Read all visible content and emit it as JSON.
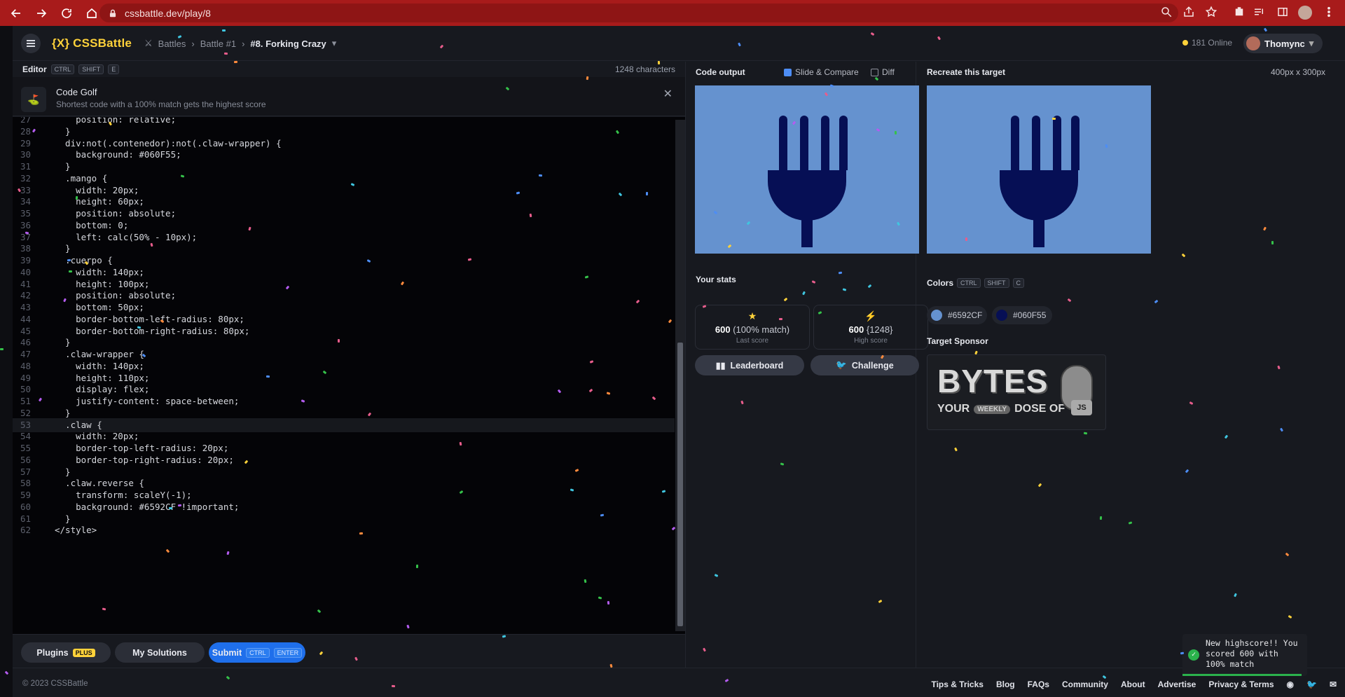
{
  "browser": {
    "url": "cssbattle.dev/play/8"
  },
  "nav": {
    "logo": "{X} CSSBattle",
    "crumbs": [
      "Battles",
      "Battle #1"
    ],
    "current": "#8. Forking Crazy",
    "online": "181 Online",
    "user": "Thomync"
  },
  "editor": {
    "title": "Editor",
    "shortcut": [
      "CTRL",
      "SHIFT",
      "E"
    ],
    "chars": "1248 characters",
    "golf_title": "Code Golf",
    "golf_sub": "Shortest code with a 100% match gets the highest score",
    "lines": [
      {
        "n": "27",
        "t": "    position: relative;"
      },
      {
        "n": "28",
        "t": "  }"
      },
      {
        "n": "29",
        "t": "  div:not(.contenedor):not(.claw-wrapper) {"
      },
      {
        "n": "30",
        "t": "    background: #060F55;"
      },
      {
        "n": "31",
        "t": "  }"
      },
      {
        "n": "32",
        "t": "  .mango {"
      },
      {
        "n": "33",
        "t": "    width: 20px;"
      },
      {
        "n": "34",
        "t": "    height: 60px;"
      },
      {
        "n": "35",
        "t": "    position: absolute;"
      },
      {
        "n": "36",
        "t": "    bottom: 0;"
      },
      {
        "n": "37",
        "t": "    left: calc(50% - 10px);"
      },
      {
        "n": "38",
        "t": "  }"
      },
      {
        "n": "39",
        "t": "  .cuerpo {"
      },
      {
        "n": "40",
        "t": "    width: 140px;"
      },
      {
        "n": "41",
        "t": "    height: 100px;"
      },
      {
        "n": "42",
        "t": "    position: absolute;"
      },
      {
        "n": "43",
        "t": "    bottom: 50px;"
      },
      {
        "n": "44",
        "t": "    border-bottom-left-radius: 80px;"
      },
      {
        "n": "45",
        "t": "    border-bottom-right-radius: 80px;"
      },
      {
        "n": "46",
        "t": "  }"
      },
      {
        "n": "47",
        "t": "  .claw-wrapper {"
      },
      {
        "n": "48",
        "t": "    width: 140px;"
      },
      {
        "n": "49",
        "t": "    height: 110px;"
      },
      {
        "n": "50",
        "t": "    display: flex;"
      },
      {
        "n": "51",
        "t": "    justify-content: space-between;"
      },
      {
        "n": "52",
        "t": "  }"
      },
      {
        "n": "53",
        "t": "  .claw {"
      },
      {
        "n": "54",
        "t": "    width: 20px;"
      },
      {
        "n": "55",
        "t": "    border-top-left-radius: 20px;"
      },
      {
        "n": "56",
        "t": "    border-top-right-radius: 20px;"
      },
      {
        "n": "57",
        "t": "  }"
      },
      {
        "n": "58",
        "t": "  .claw.reverse {"
      },
      {
        "n": "59",
        "t": "    transform: scaleY(-1);"
      },
      {
        "n": "60",
        "t": "    background: #6592CF !important;"
      },
      {
        "n": "61",
        "t": "  }"
      },
      {
        "n": "62",
        "t": "</style>"
      }
    ],
    "plugins": "Plugins",
    "plus": "PLUS",
    "solutions": "My Solutions",
    "submit": "Submit",
    "submit_keys": [
      "CTRL",
      "ENTER"
    ]
  },
  "output": {
    "title": "Code output",
    "slide": "Slide & Compare",
    "diff": "Diff",
    "stats_title": "Your stats",
    "last_value": "600",
    "last_detail": "(100% match)",
    "last_label": "Last score",
    "high_value": "600",
    "high_detail": "{1248}",
    "high_label": "High score",
    "leaderboard": "Leaderboard",
    "challenge": "Challenge"
  },
  "target": {
    "title": "Recreate this target",
    "size": "400px x 300px",
    "colors_title": "Colors",
    "colors_keys": [
      "CTRL",
      "SHIFT",
      "C"
    ],
    "colors": [
      {
        "hex": "#6592CF",
        "label": "#6592CF"
      },
      {
        "hex": "#060F55",
        "label": "#060F55"
      }
    ],
    "sponsor_title": "Target Sponsor",
    "sponsor_big": "BYTES",
    "sponsor_small1": "YOUR",
    "sponsor_weekly": "WEEKLY",
    "sponsor_small2": "DOSE OF",
    "sponsor_js": "JS"
  },
  "footer": {
    "copy": "© 2023 CSSBattle",
    "links": [
      "Tips & Tricks",
      "Blog",
      "FAQs",
      "Community",
      "About",
      "Advertise",
      "Privacy & Terms"
    ]
  },
  "toast": "New highscore!! You scored 600 with 100% match"
}
